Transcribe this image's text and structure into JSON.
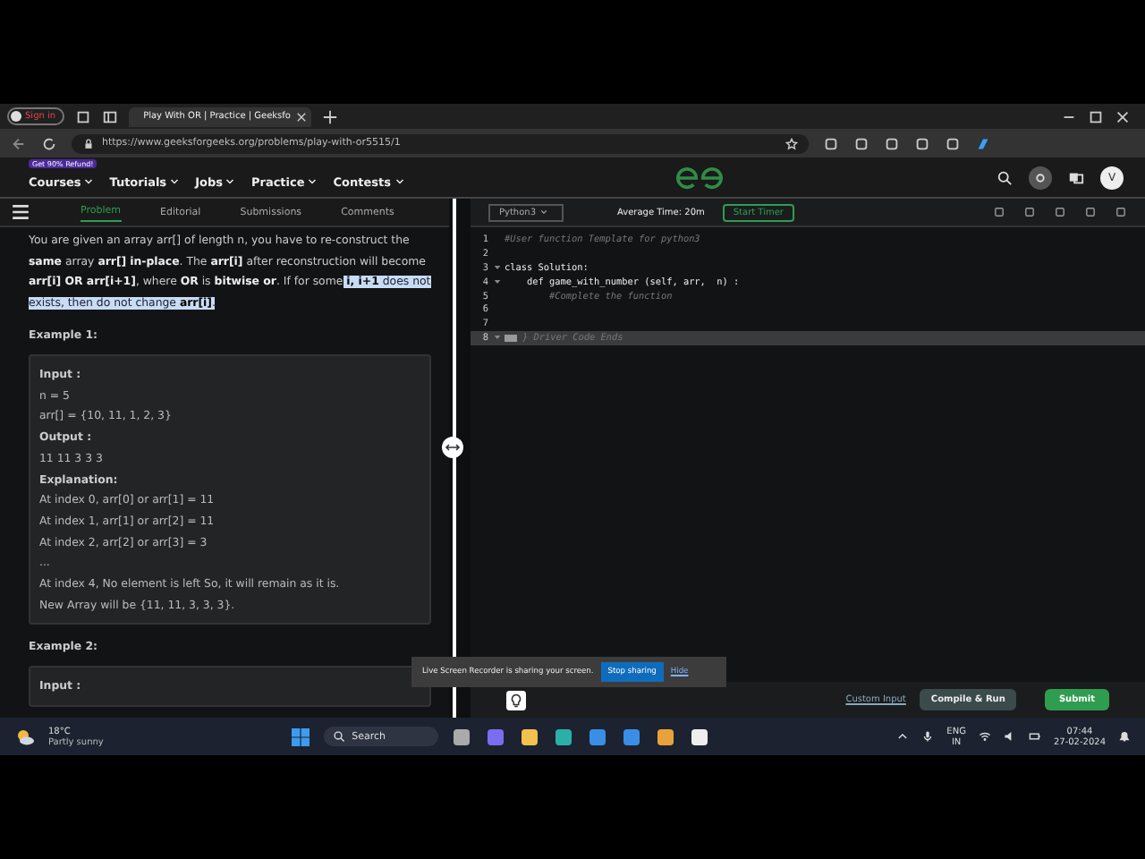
{
  "browser": {
    "profile": "Sign in",
    "tab_title": "Play With OR | Practice | Geeksfo",
    "url": "https://www.geeksforgeeks.org/problems/play-with-or5515/1"
  },
  "site_nav": {
    "badge": "Get 90% Refund!",
    "items": [
      {
        "label": "Courses"
      },
      {
        "label": "Tutorials"
      },
      {
        "label": "Jobs"
      },
      {
        "label": "Practice"
      },
      {
        "label": "Contests"
      }
    ],
    "avatar": "V"
  },
  "problem_tabs": [
    {
      "label": "Problem",
      "selected": true
    },
    {
      "label": "Editorial",
      "selected": false
    },
    {
      "label": "Submissions",
      "selected": false
    },
    {
      "label": "Comments",
      "selected": false
    }
  ],
  "problem": {
    "statement": "You are given an array arr[] of length n, you have to re-construct the **same** array **arr[]** **in-place**. The **arr[i]** after reconstruction will become **arr[i] OR arr[i+1]**, where **OR** is **bitwise or**. If for some",
    "highlighted": " **i, i+1** does not exists, then do not change **arr[i]**.",
    "examples": [
      {
        "title": "Example 1:",
        "lines": [
          {
            "text": "Input :",
            "kind": "heading"
          },
          {
            "text": "n = 5",
            "kind": "text"
          },
          {
            "text": "arr[] = {10, 11, 1, 2, 3}",
            "kind": "text"
          },
          {
            "text": "Output :",
            "kind": "heading"
          },
          {
            "text": "11 11 3 3 3",
            "kind": "text"
          },
          {
            "text": "Explanation:",
            "kind": "heading"
          },
          {
            "text": "At index 0, arr[0] or arr[1] = 11",
            "kind": "text"
          },
          {
            "text": "At index 1, arr[1] or arr[2] = 11",
            "kind": "text"
          },
          {
            "text": "At index 2, arr[2] or arr[3] = 3",
            "kind": "text"
          },
          {
            "text": "...",
            "kind": "text"
          },
          {
            "text": "At index 4, No element is left So, it will remain as it is.",
            "kind": "text"
          },
          {
            "text": "New Array will be {11, 11, 3, 3, 3}.",
            "kind": "text"
          }
        ]
      },
      {
        "title": "Example 2:",
        "lines": [
          {
            "text": "Input :",
            "kind": "heading"
          }
        ]
      }
    ]
  },
  "editor": {
    "language": "Python3",
    "average_time": "Average Time: 20m",
    "timer": "Start Timer",
    "lines": [
      {
        "number": "1",
        "text": "#User function Template for python3",
        "kind": "comment",
        "selected": false
      },
      {
        "number": "2",
        "kind": "code",
        "selected": false
      },
      {
        "number": "3",
        "text": "class Solution:",
        "kind": "code",
        "foldable": true,
        "selected": false
      },
      {
        "number": "4",
        "text": "    def game_with_number (self, arr,  n) :",
        "kind": "code",
        "foldable": true,
        "selected": false
      },
      {
        "number": "5",
        "text": "        #Complete the function",
        "kind": "comment",
        "selected": false
      },
      {
        "number": "6",
        "kind": "code",
        "selected": false
      },
      {
        "number": "7",
        "kind": "code",
        "selected": false
      },
      {
        "number": "8",
        "text": "} Driver Code Ends",
        "kind": "fold",
        "foldable": true,
        "selected": true
      }
    ]
  },
  "actions": {
    "custom_input": "Custom Input",
    "compile": "Compile & Run",
    "submit": "Submit"
  },
  "share_banner": {
    "message": "Live Screen Recorder is sharing your screen.",
    "stop": "Stop sharing",
    "hide": "Hide"
  },
  "taskbar": {
    "temperature": "18°C",
    "weather": "Partly sunny",
    "search": "Search",
    "language": "ENG",
    "region": "IN",
    "time": "07:44",
    "date": "27-02-2024"
  }
}
